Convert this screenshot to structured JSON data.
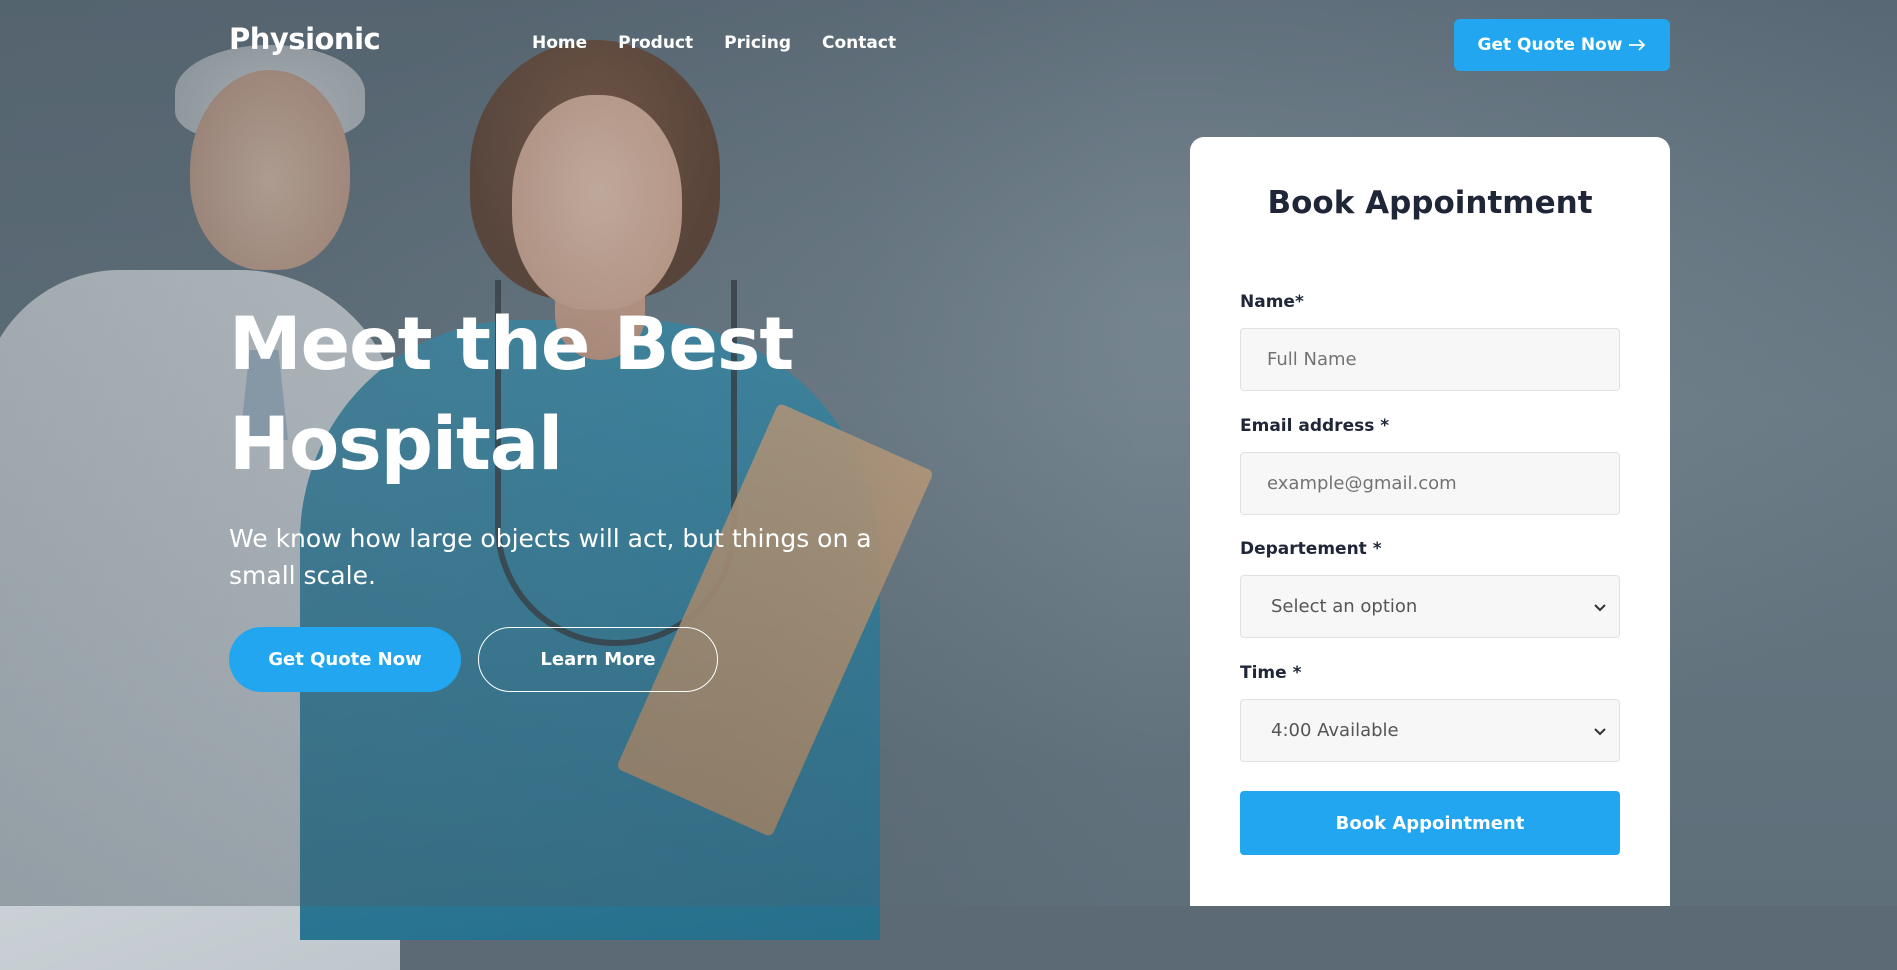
{
  "header": {
    "brand": "Physionic",
    "nav": [
      "Home",
      "Product",
      "Pricing",
      "Contact"
    ],
    "cta_label": "Get Quote Now",
    "cta_icon": "arrow-right-icon"
  },
  "hero": {
    "title_line1": "Meet the Best",
    "title_line2": "Hospital",
    "subtitle": "We know how large objects will act, but things on a small scale.",
    "primary_button": "Get Quote Now",
    "secondary_button": "Learn More"
  },
  "booking": {
    "title": "Book Appointment",
    "name_label": "Name*",
    "name_placeholder": "Full Name",
    "email_label": "Email address *",
    "email_placeholder": "example@gmail.com",
    "department_label": "Departement *",
    "department_value": "Select an option",
    "time_label": "Time *",
    "time_value": "4:00 Available",
    "submit_label": "Book Appointment"
  },
  "colors": {
    "accent": "#22a6ef",
    "heading": "#1f2637",
    "overlay": "#5b6a75"
  }
}
